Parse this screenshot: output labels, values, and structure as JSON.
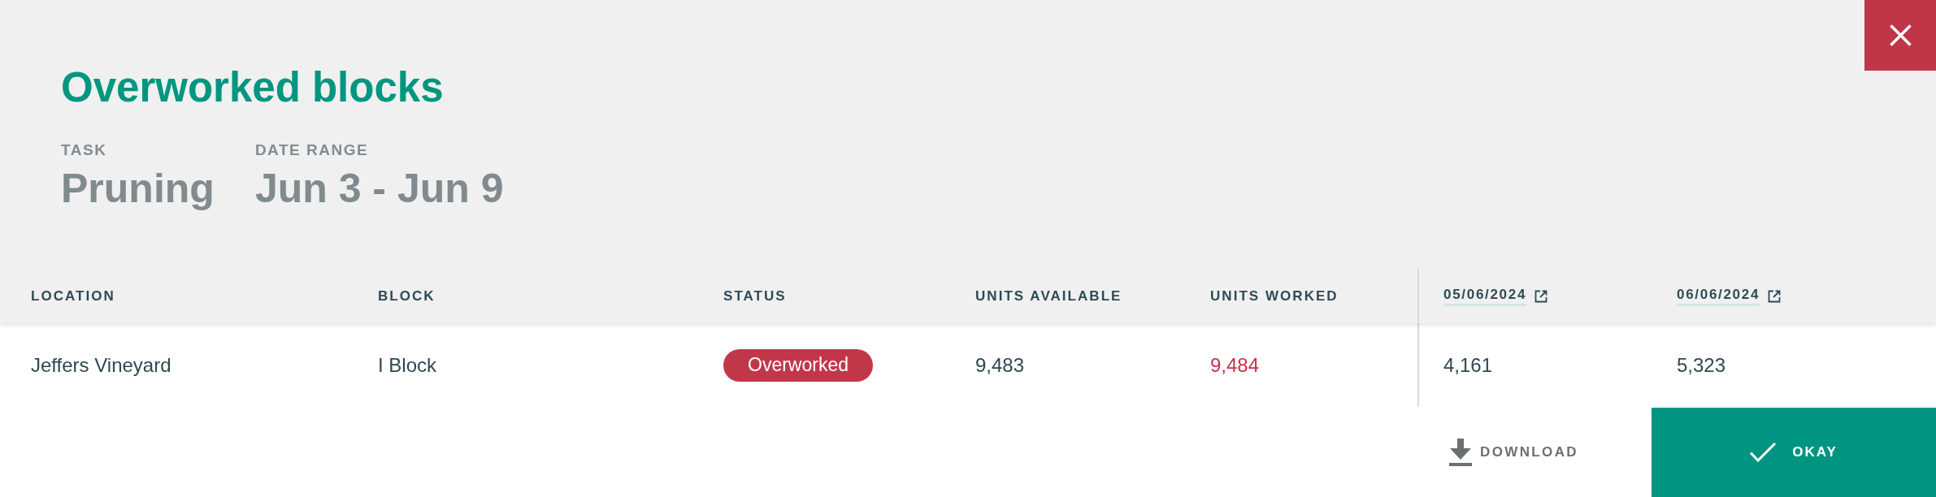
{
  "title": "Overworked blocks",
  "summary": [
    {
      "label": "TASK",
      "value": "Pruning"
    },
    {
      "label": "DATE RANGE",
      "value": "Jun 3 - Jun 9"
    }
  ],
  "table": {
    "columns": [
      {
        "label": "LOCATION",
        "kind": "text"
      },
      {
        "label": "BLOCK",
        "kind": "text"
      },
      {
        "label": "STATUS",
        "kind": "text"
      },
      {
        "label": "UNITS AVAILABLE",
        "kind": "text"
      },
      {
        "label": "UNITS WORKED",
        "kind": "text"
      },
      {
        "label": "05/06/2024",
        "kind": "day_link"
      },
      {
        "label": "06/06/2024",
        "kind": "day_link"
      }
    ],
    "rows": [
      {
        "cells": [
          {
            "kind": "text",
            "value": "Jeffers Vineyard"
          },
          {
            "kind": "text",
            "value": "I Block"
          },
          {
            "kind": "status",
            "value": "Overworked",
            "color": "#c1374a"
          },
          {
            "kind": "text",
            "value": "9,483"
          },
          {
            "kind": "number",
            "value": "9,484",
            "over": true
          },
          {
            "kind": "text",
            "value": "4,161"
          },
          {
            "kind": "text",
            "value": "5,323"
          }
        ]
      }
    ]
  },
  "actions": [
    {
      "label": "DOWNLOAD",
      "kind": "download"
    },
    {
      "label": "OKAY",
      "kind": "confirm"
    }
  ]
}
